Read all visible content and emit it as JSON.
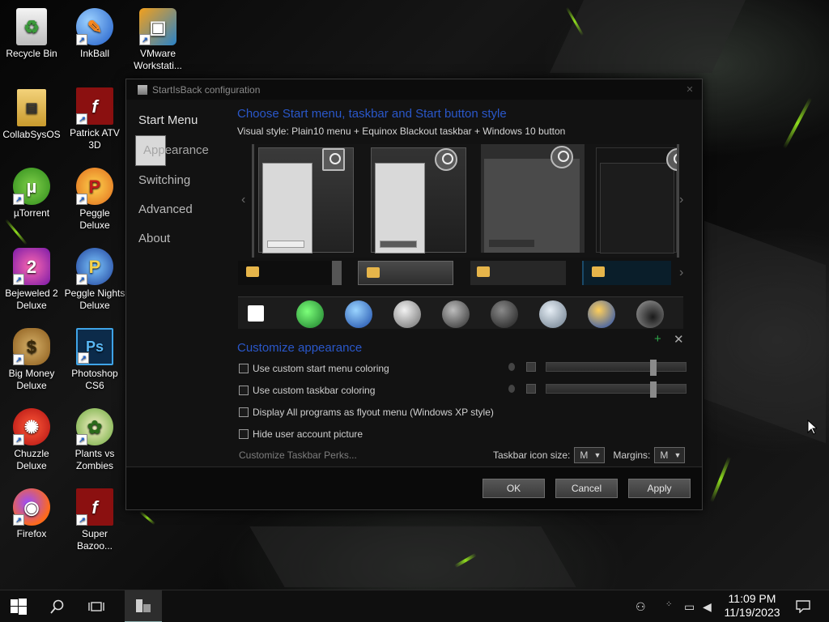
{
  "desktop": {
    "icons": [
      {
        "label": "Recycle Bin"
      },
      {
        "label": "InkBall"
      },
      {
        "label": "VMware Workstati..."
      },
      {
        "label": "CollabSysOS"
      },
      {
        "label": "Patrick ATV 3D"
      },
      {
        "label": "µTorrent"
      },
      {
        "label": "Peggle Deluxe"
      },
      {
        "label": "Bejeweled 2 Deluxe"
      },
      {
        "label": "Peggle Nights Deluxe"
      },
      {
        "label": "Big Money Deluxe"
      },
      {
        "label": "Photoshop CS6"
      },
      {
        "label": "Chuzzle Deluxe"
      },
      {
        "label": "Plants vs Zombies"
      },
      {
        "label": "Firefox"
      },
      {
        "label": "Super Bazoo..."
      }
    ]
  },
  "dialog": {
    "title": "StartIsBack configuration",
    "nav": [
      "Start Menu",
      "Appearance",
      "Switching",
      "Advanced",
      "About"
    ],
    "selected_nav": "Appearance",
    "style_heading": "Choose Start menu, taskbar and Start button style",
    "visual_style": "Visual style:  Plain10 menu + Equinox Blackout taskbar + Windows 10 button",
    "customize_heading": "Customize appearance",
    "options": [
      {
        "label": "Use custom start menu coloring",
        "checked": false
      },
      {
        "label": "Use custom taskbar coloring",
        "checked": false
      },
      {
        "label": "Display All programs as flyout menu (Windows XP style)",
        "checked": false
      },
      {
        "label": "Hide user account picture",
        "checked": false
      }
    ],
    "perks_link": "Customize Taskbar Perks...",
    "taskbar_icon_size_label": "Taskbar icon size:",
    "taskbar_icon_size_value": "M",
    "margins_label": "Margins:",
    "margins_value": "M",
    "buttons": {
      "ok": "OK",
      "cancel": "Cancel",
      "apply": "Apply"
    }
  },
  "taskbar": {
    "time": "11:09 PM",
    "date": "11/19/2023"
  },
  "colors": {
    "accent_blue": "#2a57c9",
    "streak_green": "#8edc1e"
  }
}
